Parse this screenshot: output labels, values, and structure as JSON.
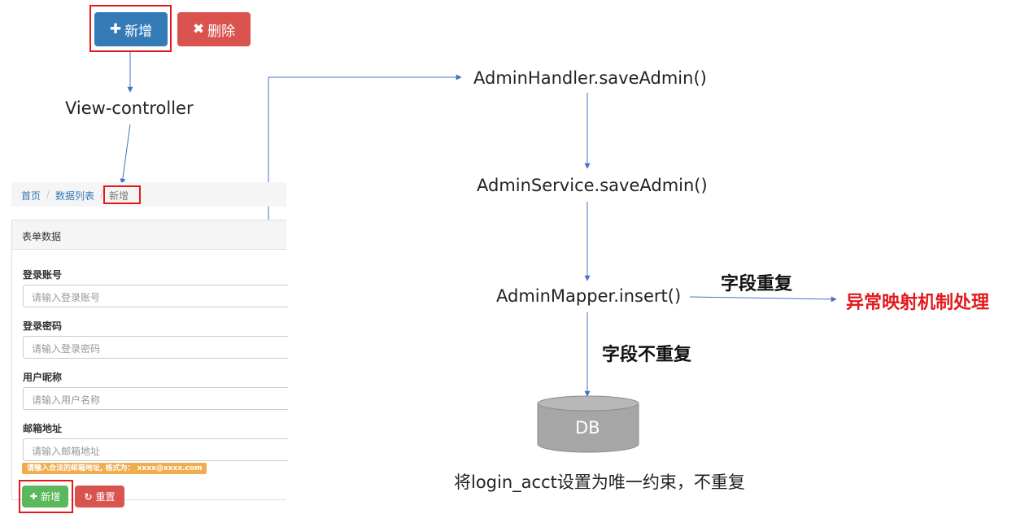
{
  "top_buttons": {
    "add_label": "新增",
    "delete_label": "删除",
    "add_icon": "plus-icon",
    "delete_icon": "x-icon"
  },
  "flow": {
    "view_controller": "View-controller",
    "handler": "AdminHandler.saveAdmin()",
    "service": "AdminService.saveAdmin()",
    "mapper": "AdminMapper.insert()",
    "dup_label": "字段重复",
    "exception": "异常映射机制处理",
    "nodup_label": "字段不重复",
    "db_label": "DB",
    "constraint_note": "将login_acct设置为唯一约束，不重复"
  },
  "breadcrumb": {
    "home": "首页",
    "sep": "/",
    "list": "数据列表",
    "current": "新增"
  },
  "form": {
    "panel_title": "表单数据",
    "fields": [
      {
        "label": "登录账号",
        "placeholder": "请输入登录账号"
      },
      {
        "label": "登录密码",
        "placeholder": "请输入登录密码"
      },
      {
        "label": "用户昵称",
        "placeholder": "请输入用户名称"
      },
      {
        "label": "邮箱地址",
        "placeholder": "请输入邮箱地址"
      }
    ],
    "email_hint": "请输入合法的邮箱地址, 格式为： xxxx@xxxx.com",
    "submit_label": "新增",
    "reset_label": "重置"
  },
  "colors": {
    "primary": "#337ab7",
    "danger": "#d9534f",
    "success": "#5cb85c",
    "warning": "#f0ad4e",
    "highlight": "#e3191c",
    "arrow": "#4472c4",
    "db": "#a6a6a6"
  }
}
